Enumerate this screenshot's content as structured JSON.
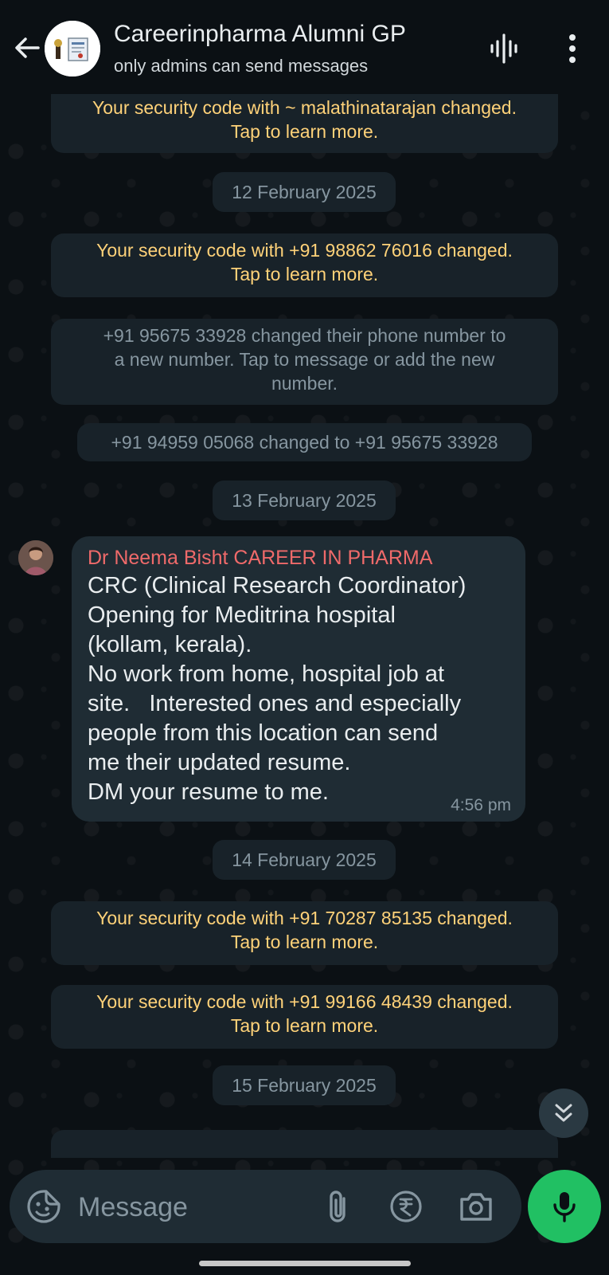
{
  "header": {
    "title": "Careerinpharma Alumni GP",
    "subtitle": "only admins can send messages",
    "icons": [
      "back-arrow-icon",
      "voice-chat-icon",
      "more-options-icon"
    ]
  },
  "chat": {
    "sys1": {
      "line1": "Your security code with ~ malathinatarajan changed.",
      "line2": "Tap to learn more."
    },
    "date1": "12 February 2025",
    "sys2": {
      "line1": "Your security code with +91 98862 76016 changed.",
      "line2": "Tap to learn more."
    },
    "sys3": {
      "line1": "+91 95675 33928 changed their phone number to",
      "line2": "a new number. Tap to message or add the new",
      "line3": "number."
    },
    "sys4": "+91 94959 05068 changed to +91 95675 33928",
    "date2": "13 February 2025",
    "message": {
      "sender": "Dr Neema Bisht CAREER IN PHARMA",
      "lines": [
        "CRC (Clinical Research Coordinator)",
        "Opening for Meditrina hospital",
        "(kollam, kerala).",
        "No work from home, hospital job at",
        "site.   Interested ones and especially",
        "people from this location can send",
        "me their updated resume.",
        "DM your resume to me."
      ],
      "time": "4:56 pm"
    },
    "date3": "14 February 2025",
    "sys5": {
      "line1": "Your security code with +91 70287 85135 changed.",
      "line2": "Tap to learn more."
    },
    "sys6": {
      "line1": "Your security code with +91 99166 48439 changed.",
      "line2": "Tap to learn more."
    },
    "date4": "15 February 2025"
  },
  "input": {
    "placeholder": "Message"
  },
  "colors": {
    "background": "#0b1014",
    "bubble": "#1f2c34",
    "system_bubble": "#182229",
    "system_text_yellow": "#ffd279",
    "sender_name": "#ef6a6a",
    "send_button": "#21c063"
  }
}
